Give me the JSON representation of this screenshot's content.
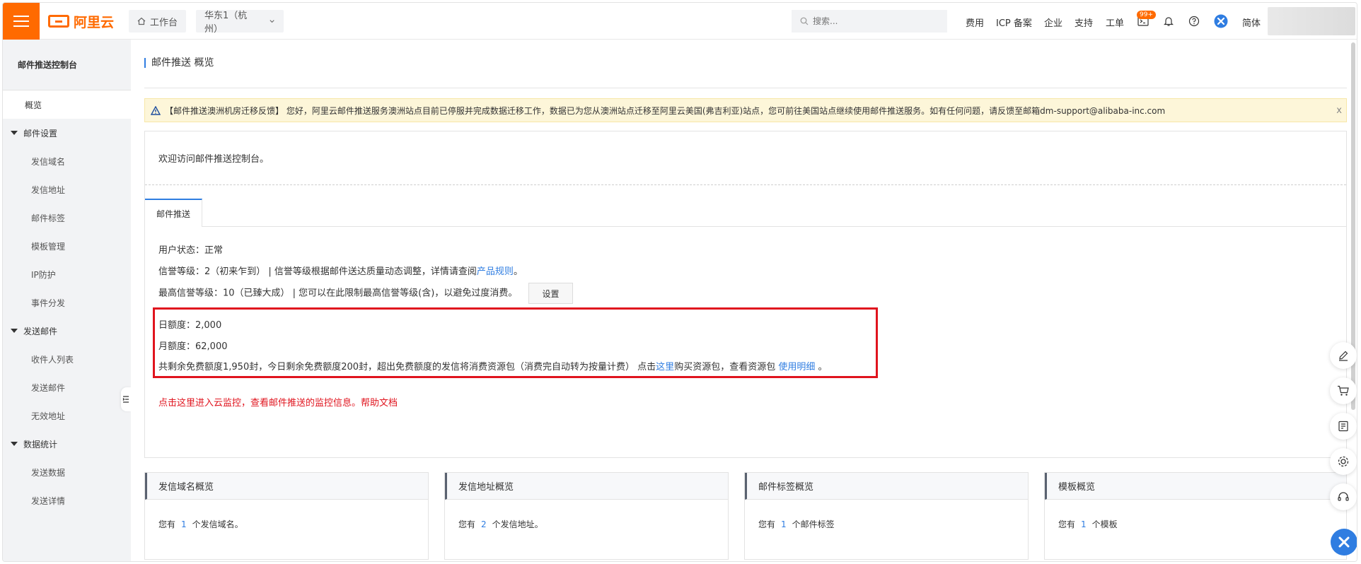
{
  "header": {
    "logo_text": "阿里云",
    "workbench_label": "工作台",
    "region_label": "华东1（杭州）",
    "search_placeholder": "搜索...",
    "links": [
      "费用",
      "ICP 备案",
      "企业",
      "支持",
      "工单"
    ],
    "notification_badge": "99+",
    "language_label": "简体"
  },
  "sidebar": {
    "title": "邮件推送控制台",
    "active_item": "概览",
    "groups": [
      {
        "label": "邮件设置",
        "items": [
          "发信域名",
          "发信地址",
          "邮件标签",
          "模板管理",
          "IP防护",
          "事件分发"
        ]
      },
      {
        "label": "发送邮件",
        "items": [
          "收件人列表",
          "发送邮件",
          "无效地址"
        ]
      },
      {
        "label": "数据统计",
        "items": [
          "发送数据",
          "发送详情"
        ]
      }
    ]
  },
  "main": {
    "page_title": "邮件推送 概览",
    "notice": "【邮件推送澳洲机房迁移反馈】 您好，阿里云邮件推送服务澳洲站点目前已停服并完成数据迁移工作，数据已为您从澳洲站点迁移至阿里云美国(弗吉利亚)站点，您可前往美国站点继续使用邮件推送服务。如有任何问题，请反馈至邮箱dm-support@alibaba-inc.com",
    "notice_close": "x",
    "welcome": "欢迎访问邮件推送控制台。",
    "tab_label": "邮件推送",
    "user_status": "用户状态：正常",
    "credit_level_text": "信誉等级：2（初来乍到） | 信誉等级根据邮件送达质量动态调整，详情请查阅",
    "credit_level_link": "产品规则",
    "credit_level_suffix": "。",
    "max_level_text": "最高信誉等级：10（已臻大成） | 您可以在此限制最高信誉等级(含)，以避免过度消费。",
    "settings_button": "设置",
    "daily_quota": "日额度：2,000",
    "monthly_quota": "月额度：62,000",
    "free_quota_text": "共剩余免费额度1,950封，今日剩余免费额度200封，超出免费额度的发信将消费资源包（消费完自动转为按量计费）  点击",
    "here_link": "这里",
    "buy_text": "购买资源包，查看资源包 ",
    "usage_link": "使用明细",
    "usage_suffix": " 。",
    "monitor_text": "点击这里进入云监控，查看邮件推送的监控信息。",
    "help_link": "帮助文档"
  },
  "cards": [
    {
      "title": "发信域名概览",
      "prefix": "您有",
      "count": "1",
      "suffix": "个发信域名。"
    },
    {
      "title": "发信地址概览",
      "prefix": "您有",
      "count": "2",
      "suffix": "个发信地址。"
    },
    {
      "title": "邮件标签概览",
      "prefix": "您有",
      "count": "1",
      "suffix": "个邮件标签"
    },
    {
      "title": "模板概览",
      "prefix": "您有",
      "count": "1",
      "suffix": "个模板"
    }
  ],
  "colors": {
    "brand": "#ff6a00",
    "link": "#2f7de1",
    "alert": "#e0141e",
    "notice_bg": "#fdf6d9"
  }
}
